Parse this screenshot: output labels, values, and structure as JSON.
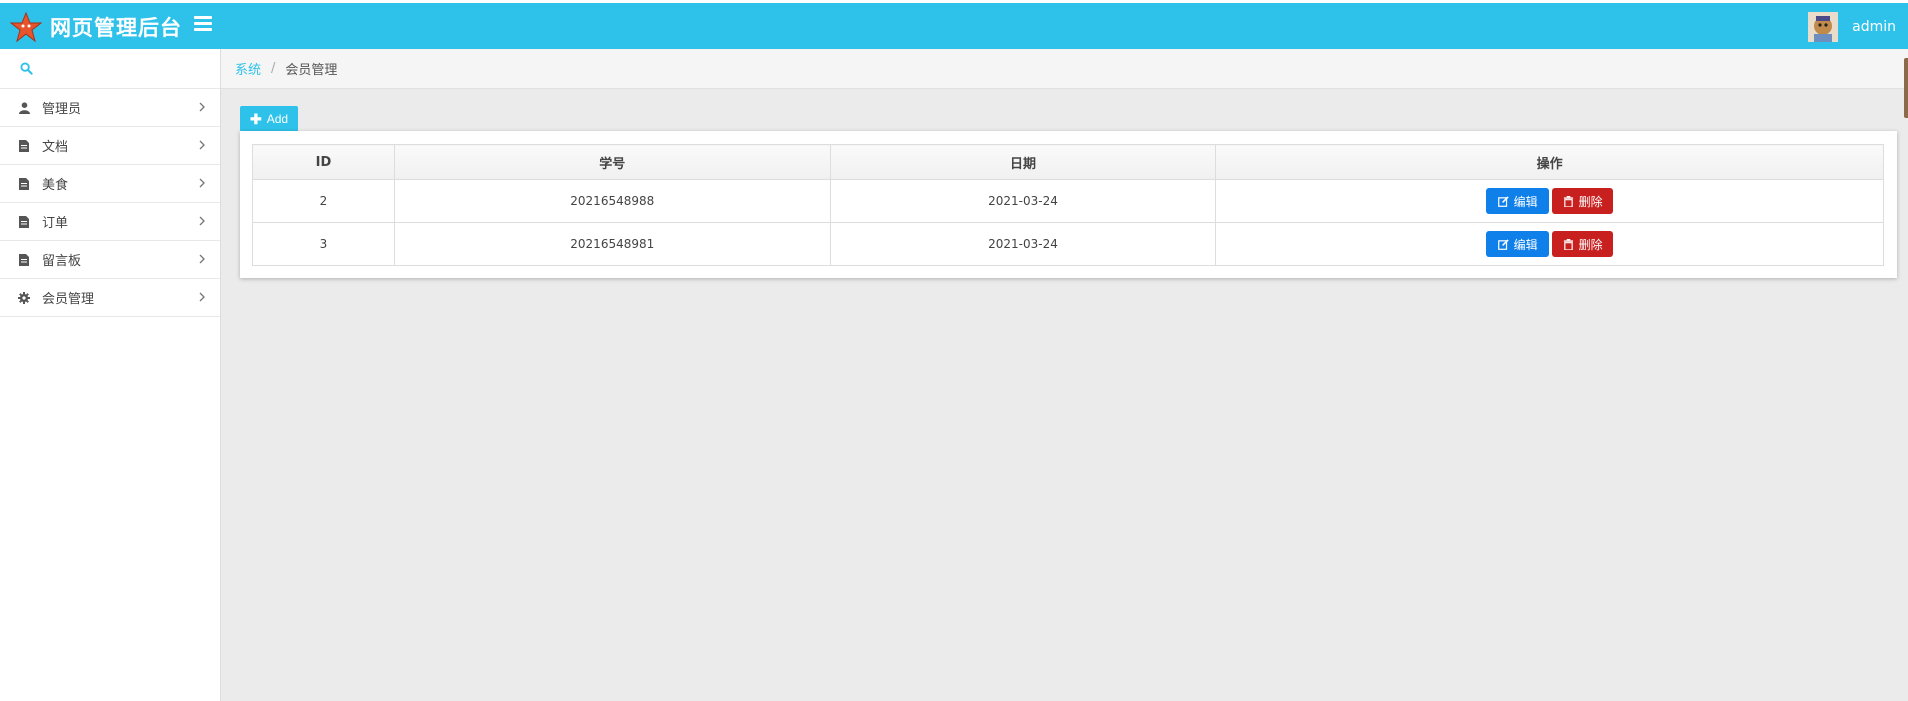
{
  "header": {
    "title": "网页管理后台",
    "username": "admin",
    "logo_icon": "star-logo-icon",
    "accent_color": "#2ec2ea"
  },
  "sidebar": {
    "items": [
      {
        "label": "管理员",
        "icon": "user-icon"
      },
      {
        "label": "文档",
        "icon": "document-icon"
      },
      {
        "label": "美食",
        "icon": "document-icon"
      },
      {
        "label": "订单",
        "icon": "document-icon"
      },
      {
        "label": "留言板",
        "icon": "document-icon"
      },
      {
        "label": "会员管理",
        "icon": "gear-icon"
      }
    ]
  },
  "breadcrumb": {
    "root": "系统",
    "separator": "/",
    "current": "会员管理"
  },
  "toolbar": {
    "add_label": "Add"
  },
  "table": {
    "columns": [
      "ID",
      "学号",
      "日期",
      "操作"
    ],
    "rows": [
      {
        "id": "2",
        "student_no": "20216548988",
        "date": "2021-03-24"
      },
      {
        "id": "3",
        "student_no": "20216548981",
        "date": "2021-03-24"
      }
    ],
    "edit_label": "编辑",
    "delete_label": "删除"
  }
}
